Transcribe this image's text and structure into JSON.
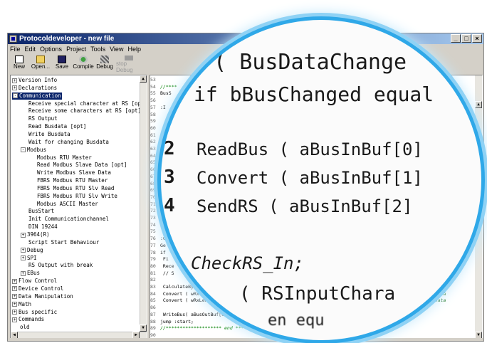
{
  "window": {
    "title": "Protocoldeveloper - new file",
    "controls": [
      "_",
      "□",
      "×"
    ]
  },
  "menu": [
    "File",
    "Edit",
    "Options",
    "Project",
    "Tools",
    "View",
    "Help"
  ],
  "toolbar": [
    {
      "label": "New",
      "icon": "new-file-icon",
      "enabled": true
    },
    {
      "label": "Open...",
      "icon": "open-folder-icon",
      "enabled": true
    },
    {
      "label": "Save",
      "icon": "save-disk-icon",
      "enabled": true
    },
    {
      "label": "Compile",
      "icon": "compile-icon",
      "enabled": true
    },
    {
      "label": "Debug",
      "icon": "debug-icon",
      "enabled": true
    },
    {
      "label": "stop Debug",
      "icon": "stop-debug-icon",
      "enabled": false
    }
  ],
  "tree": [
    {
      "label": "Version Info",
      "level": 0,
      "expander": "+"
    },
    {
      "label": "Declarations",
      "level": 0,
      "expander": "+"
    },
    {
      "label": "Communication",
      "level": 0,
      "expander": "-",
      "selected": true
    },
    {
      "label": "Receive special character at RS [opt]",
      "level": 1
    },
    {
      "label": "Receive some characters at RS [opt]",
      "level": 1
    },
    {
      "label": "RS Output",
      "level": 1
    },
    {
      "label": "Read Busdata [opt]",
      "level": 1
    },
    {
      "label": "Write Busdata",
      "level": 1
    },
    {
      "label": "Wait for changing Busdata",
      "level": 1
    },
    {
      "label": "Modbus",
      "level": 1,
      "expander": "-"
    },
    {
      "label": "Modbus RTU Master",
      "level": 2
    },
    {
      "label": "Read Modbus Slave Data [opt]",
      "level": 2
    },
    {
      "label": "Write Modbus Slave Data",
      "level": 2
    },
    {
      "label": "FBRS Modbus RTU Master",
      "level": 2
    },
    {
      "label": "FBRS Modbus RTU Slv Read",
      "level": 2
    },
    {
      "label": "FBRS Modbus RTU Slv Write",
      "level": 2
    },
    {
      "label": "Modbus ASCII Master",
      "level": 2
    },
    {
      "label": "BusStart",
      "level": 1
    },
    {
      "label": "Init Communicationchannel",
      "level": 1
    },
    {
      "label": "DIN 19244",
      "level": 1
    },
    {
      "label": "3964(R)",
      "level": 1,
      "expander": "+"
    },
    {
      "label": "Script Start Behaviour",
      "level": 1
    },
    {
      "label": "Debug",
      "level": 1,
      "expander": "+"
    },
    {
      "label": "SPI",
      "level": 1,
      "expander": "+"
    },
    {
      "label": "RS Output with break",
      "level": 1
    },
    {
      "label": "EBus",
      "level": 1,
      "expander": "+"
    },
    {
      "label": "Flow Control",
      "level": 0,
      "expander": "+"
    },
    {
      "label": "Device Control",
      "level": 0,
      "expander": "+"
    },
    {
      "label": "Data Manipulation",
      "level": 0,
      "expander": "+"
    },
    {
      "label": "Math",
      "level": 0,
      "expander": "+"
    },
    {
      "label": "Bus specific",
      "level": 0,
      "expander": "+"
    },
    {
      "label": "Commands",
      "level": 0,
      "expander": "+"
    },
    {
      "label": "old",
      "level": 0
    }
  ],
  "editor_lines": [
    {
      "n": "53",
      "text": ""
    },
    {
      "n": "54",
      "text": "//****"
    },
    {
      "n": "55",
      "text": "BusS"
    },
    {
      "n": "56",
      "text": ""
    },
    {
      "n": "57",
      "text": ":I"
    },
    {
      "n": "58",
      "text": ""
    },
    {
      "n": "59",
      "text": ""
    },
    {
      "n": "60",
      "text": ""
    },
    {
      "n": "61",
      "text": ""
    },
    {
      "n": "62",
      "text": ""
    },
    {
      "n": "63",
      "text": ""
    },
    {
      "n": "64",
      "text": ""
    },
    {
      "n": "65",
      "text": ""
    },
    {
      "n": "66",
      "text": ""
    },
    {
      "n": "67",
      "text": ""
    },
    {
      "n": "68",
      "text": ""
    },
    {
      "n": "69",
      "text": ""
    },
    {
      "n": "70",
      "text": ""
    },
    {
      "n": "71",
      "text": ""
    },
    {
      "n": "72",
      "text": ""
    },
    {
      "n": "73",
      "text": ""
    },
    {
      "n": "74",
      "text": ""
    },
    {
      "n": "75",
      "text": ""
    },
    {
      "n": "76",
      "text": ":C"
    },
    {
      "n": "77",
      "text": "Ge"
    },
    {
      "n": "78",
      "text": "if"
    },
    {
      "n": "79",
      "text": "  Fi"
    },
    {
      "n": "80",
      "text": "  Rece"
    },
    {
      "n": "81",
      "text": "   // S"
    },
    {
      "n": "82",
      "text": ""
    },
    {
      "n": "83",
      "text": "  CalculateBy"
    },
    {
      "n": "84",
      "text": "  Convert ( wRx"
    },
    {
      "n": "85",
      "text": "  Convert ( wRxLen"
    },
    {
      "n": "86",
      "text": ""
    },
    {
      "n": "87",
      "text": "  WriteBus( aBusOutBuf[0],"
    },
    {
      "n": "88",
      "text": "jump :start;"
    },
    {
      "n": "89",
      "text": "//******************** end **********"
    },
    {
      "n": "90",
      "text": ""
    }
  ],
  "editor_comments": {
    "line84": "ur Data",
    "line85": "Buf Data",
    "line87": "// !!!"
  },
  "magnifier": {
    "lines": [
      {
        "num": "",
        "text": "et ( BusDataChange"
      },
      {
        "num": "",
        "text": "if bBusChanged equal"
      },
      {
        "num": "2",
        "text": "ReadBus ( aBusInBuf[0]"
      },
      {
        "num": "3",
        "text": "Convert ( aBusInBuf[1]"
      },
      {
        "num": "4",
        "text": "SendRS ( aBusInBuf[2]"
      },
      {
        "num": "",
        "text": "CheckRS_In;"
      },
      {
        "num": "",
        "text": "( RSInputChara"
      },
      {
        "num": "",
        "text": "en equ"
      }
    ]
  },
  "colors": {
    "title_bar": "#0a246a",
    "magnifier_ring": "#2fa8e8",
    "comment": "#008000",
    "selection": "#0a246a"
  }
}
